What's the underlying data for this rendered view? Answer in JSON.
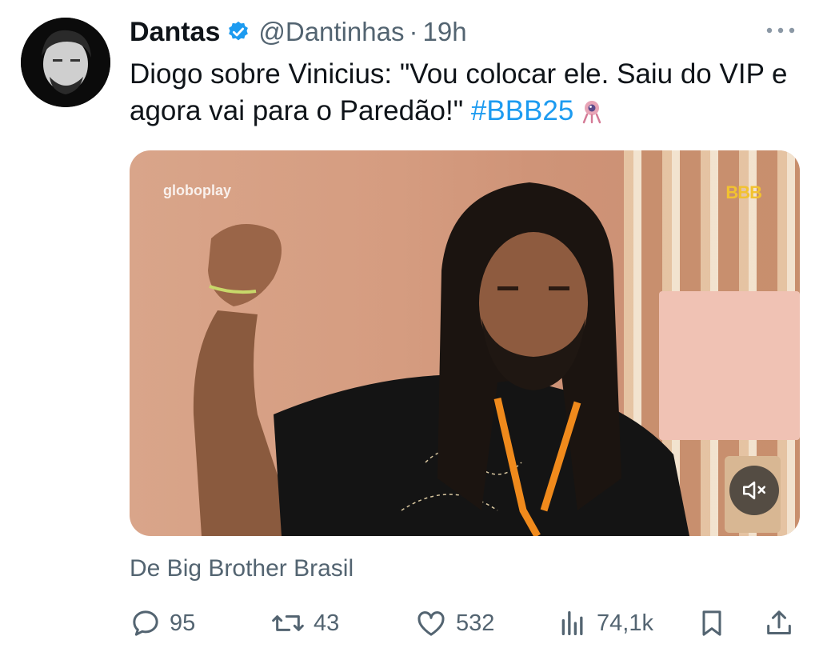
{
  "tweet": {
    "author_name": "Dantas",
    "handle": "@Dantinhas",
    "separator": "·",
    "time": "19h",
    "text_main": "Diogo sobre Vinicius: \"Vou colocar ele. Saiu do VIP e agora vai para o Paredão!\"",
    "hashtag": "#BBB25",
    "media": {
      "watermark": "globoplay",
      "logo": "BBB"
    },
    "source": "De Big Brother Brasil",
    "stats": {
      "replies": "95",
      "retweets": "43",
      "likes": "532",
      "views": "74,1k"
    }
  },
  "icons": [
    "verified-badge-icon",
    "more-icon",
    "bbb-camera-emoji-icon",
    "mute-icon",
    "reply-icon",
    "retweet-icon",
    "like-icon",
    "views-icon",
    "bookmark-icon",
    "share-icon"
  ],
  "colors": {
    "accent": "#1d9bf0",
    "text": "#0f1419",
    "muted": "#536471"
  }
}
